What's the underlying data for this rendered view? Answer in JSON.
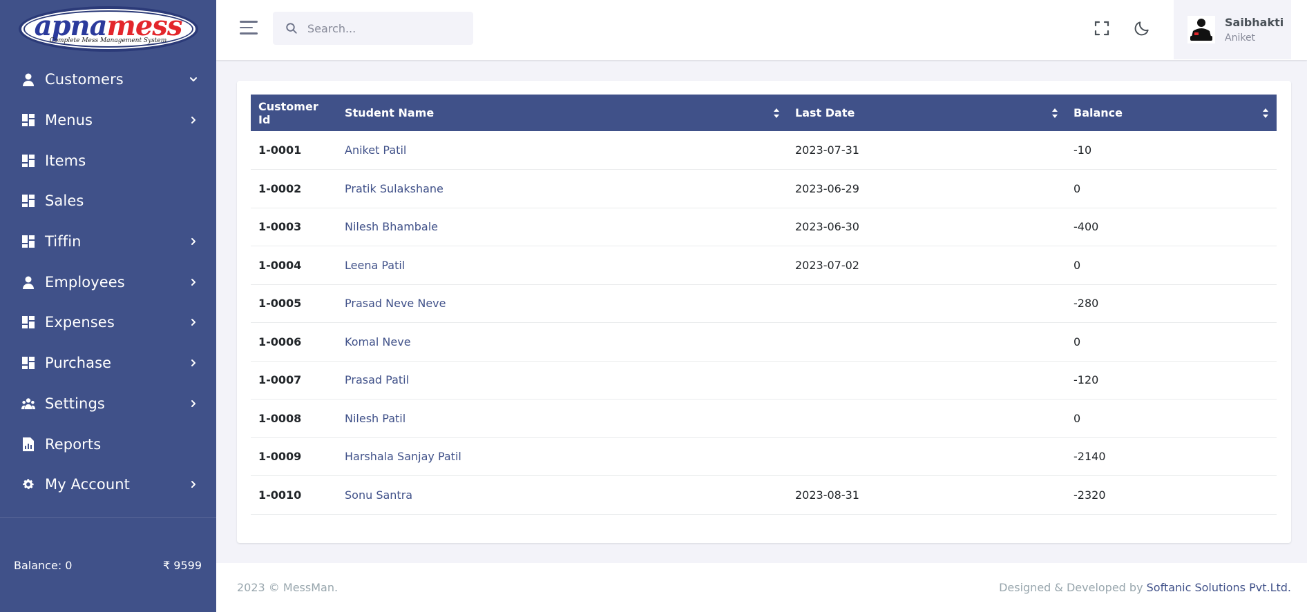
{
  "brand": {
    "logo_part1": "apna",
    "logo_part2": "mess",
    "logo_tagline": "Complete Mess Management System"
  },
  "sidebar": {
    "items": [
      {
        "label": "Customers",
        "icon": "user-icon",
        "chevron": "down"
      },
      {
        "label": "Menus",
        "icon": "dashboard-icon",
        "chevron": "right"
      },
      {
        "label": "Items",
        "icon": "dashboard-icon",
        "chevron": ""
      },
      {
        "label": "Sales",
        "icon": "dashboard-icon",
        "chevron": ""
      },
      {
        "label": "Tiffin",
        "icon": "dashboard-icon",
        "chevron": "right"
      },
      {
        "label": "Employees",
        "icon": "user-icon",
        "chevron": "right"
      },
      {
        "label": "Expenses",
        "icon": "dashboard-icon",
        "chevron": "right"
      },
      {
        "label": "Purchase",
        "icon": "dashboard-icon",
        "chevron": "right"
      },
      {
        "label": "Settings",
        "icon": "team-icon",
        "chevron": "right"
      },
      {
        "label": "Reports",
        "icon": "report-icon",
        "chevron": ""
      },
      {
        "label": "My Account",
        "icon": "gear-icon",
        "chevron": "right"
      }
    ],
    "footer": {
      "balance_label": "Balance: 0",
      "amount": "₹ 9599"
    }
  },
  "topbar": {
    "search_placeholder": "Search...",
    "user": {
      "name": "Saibhakti",
      "role": "Aniket"
    }
  },
  "table": {
    "headers": [
      "Customer Id",
      "Student Name",
      "Last Date",
      "Balance"
    ],
    "rows": [
      {
        "id": "1-0001",
        "name": "Aniket Patil",
        "last_date": "2023-07-31",
        "balance": "-10"
      },
      {
        "id": "1-0002",
        "name": "Pratik Sulakshane",
        "last_date": "2023-06-29",
        "balance": "0"
      },
      {
        "id": "1-0003",
        "name": "Nilesh Bhambale",
        "last_date": "2023-06-30",
        "balance": "-400"
      },
      {
        "id": "1-0004",
        "name": "Leena Patil",
        "last_date": "2023-07-02",
        "balance": "0"
      },
      {
        "id": "1-0005",
        "name": "Prasad Neve Neve",
        "last_date": "",
        "balance": "-280"
      },
      {
        "id": "1-0006",
        "name": "Komal Neve",
        "last_date": "",
        "balance": "0"
      },
      {
        "id": "1-0007",
        "name": "Prasad Patil",
        "last_date": "",
        "balance": "-120"
      },
      {
        "id": "1-0008",
        "name": "Nilesh Patil",
        "last_date": "",
        "balance": "0"
      },
      {
        "id": "1-0009",
        "name": "Harshala Sanjay Patil",
        "last_date": "",
        "balance": "-2140"
      },
      {
        "id": "1-0010",
        "name": "Sonu Santra",
        "last_date": "2023-08-31",
        "balance": "-2320"
      }
    ]
  },
  "footer": {
    "copyright": "2023 © MessMan.",
    "designed_by": "Designed & Developed by",
    "company": "Softanic Solutions Pvt.Ltd."
  },
  "colors": {
    "primary": "#405189",
    "background": "#f3f3f9",
    "logo_blue": "#2b3a9c",
    "logo_red": "#e3262b"
  }
}
